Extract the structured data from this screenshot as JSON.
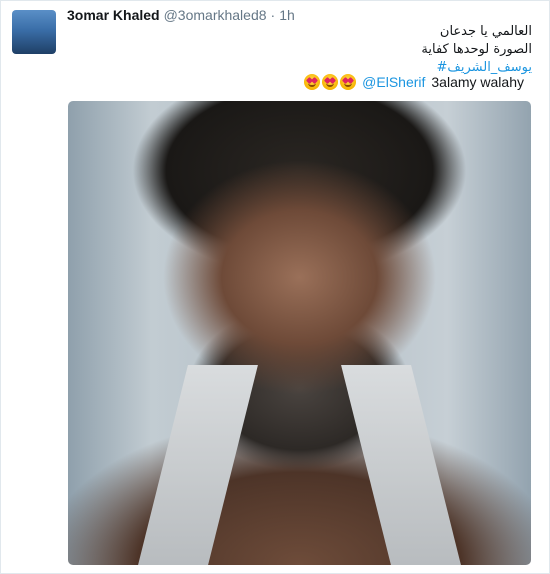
{
  "tweet": {
    "author_name": "3omar Khaled",
    "author_handle": "@3omarkhaled8",
    "separator": "·",
    "time": "1h",
    "text_lines": [
      "العالمي يا جدعان",
      "الصورة لوحدها كفاية"
    ],
    "hashtag": "#يوسف_الشريف",
    "mention": "@ElSherif",
    "tail_text": "3alamy walahy",
    "emoji_count": 3,
    "emoji_name": "heart-eyes-emoji"
  },
  "colors": {
    "link": "#1b95e0",
    "name": "#14171a",
    "meta": "#657786",
    "border": "#e1e8ed"
  }
}
